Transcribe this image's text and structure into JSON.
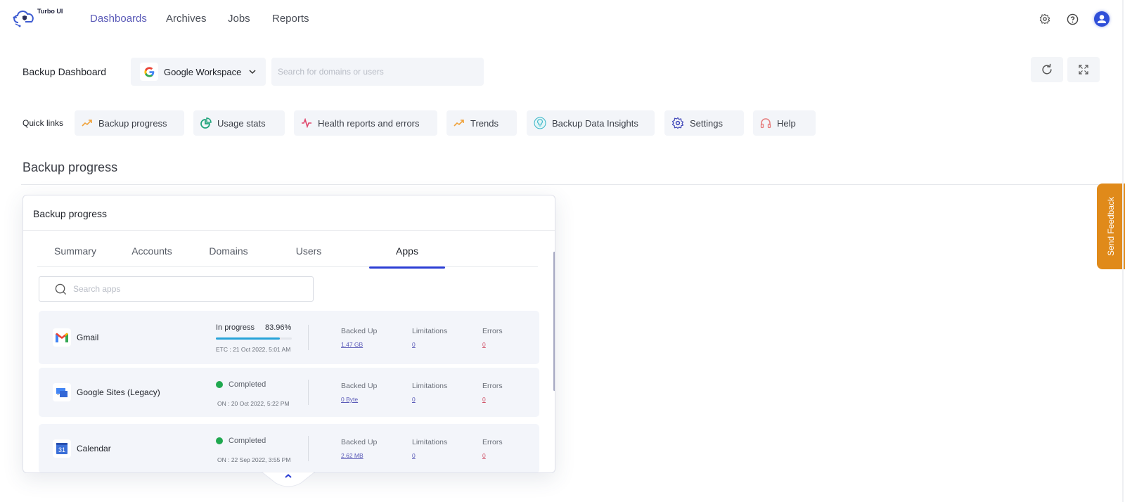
{
  "app": {
    "name": "Turbo UI"
  },
  "nav": {
    "items": [
      {
        "label": "Dashboards",
        "active": true
      },
      {
        "label": "Archives",
        "active": false
      },
      {
        "label": "Jobs",
        "active": false
      },
      {
        "label": "Reports",
        "active": false
      }
    ],
    "icons": [
      "gear-icon",
      "help-icon",
      "user-avatar-icon"
    ]
  },
  "toolbar": {
    "page_title": "Backup Dashboard",
    "workspace_select": {
      "value": "Google Workspace",
      "icon": "google-g-icon"
    },
    "search": {
      "placeholder": "Search for domains or users",
      "value": ""
    },
    "buttons": [
      "refresh-icon",
      "fullscreen-icon"
    ]
  },
  "quick_links": {
    "label": "Quick links",
    "items": [
      {
        "label": "Backup progress",
        "icon": "trend-up-icon",
        "color": "#f0a23a"
      },
      {
        "label": "Usage stats",
        "icon": "pie-chart-icon",
        "color": "#1ea37a"
      },
      {
        "label": "Health reports and errors",
        "icon": "pulse-icon",
        "color": "#e0466b"
      },
      {
        "label": "Trends",
        "icon": "trend-up-icon",
        "color": "#f0a23a"
      },
      {
        "label": "Backup Data Insights",
        "icon": "lightbulb-icon",
        "color": "#39b6c8"
      },
      {
        "label": "Settings",
        "icon": "gear-icon",
        "color": "#3f46b8"
      },
      {
        "label": "Help",
        "icon": "headphones-icon",
        "color": "#e67b7b"
      }
    ]
  },
  "section": {
    "title": "Backup progress"
  },
  "card": {
    "title": "Backup progress",
    "tabs": [
      {
        "label": "Summary",
        "active": false
      },
      {
        "label": "Accounts",
        "active": false
      },
      {
        "label": "Domains",
        "active": false
      },
      {
        "label": "Users",
        "active": false
      },
      {
        "label": "Apps",
        "active": true
      }
    ],
    "search": {
      "placeholder": "Search apps",
      "value": ""
    },
    "metric_labels": {
      "backed_up": "Backed Up",
      "limitations": "Limitations",
      "errors": "Errors"
    },
    "apps": [
      {
        "name": "Gmail",
        "icon": "gmail-icon",
        "status": "In progress",
        "progress_percent": "83.96%",
        "progress_fraction": 0.8396,
        "date": "ETC : 21 Oct 2022, 5:01 AM",
        "backed_up": "1.47 GB",
        "limitations": "0",
        "errors": "0"
      },
      {
        "name": "Google Sites (Legacy)",
        "icon": "google-sites-icon",
        "status": "Completed",
        "date": "ON : 20 Oct 2022, 5:22 PM",
        "backed_up": "0 Byte",
        "limitations": "0",
        "errors": "0"
      },
      {
        "name": "Calendar",
        "icon": "google-calendar-icon",
        "calendar_day": "31",
        "status": "Completed",
        "date": "ON : 22 Sep 2022, 3:55 PM",
        "backed_up": "2.62 MB",
        "limitations": "0",
        "errors": "0"
      }
    ]
  },
  "feedback": {
    "label": "Send Feedback"
  },
  "colors": {
    "accent": "#2b3ed4",
    "nav_active": "#5b5bb8",
    "progress": "#27a3d8",
    "completed": "#1fa84f",
    "feedback": "#e08a1a",
    "error_link": "#d0546a"
  }
}
